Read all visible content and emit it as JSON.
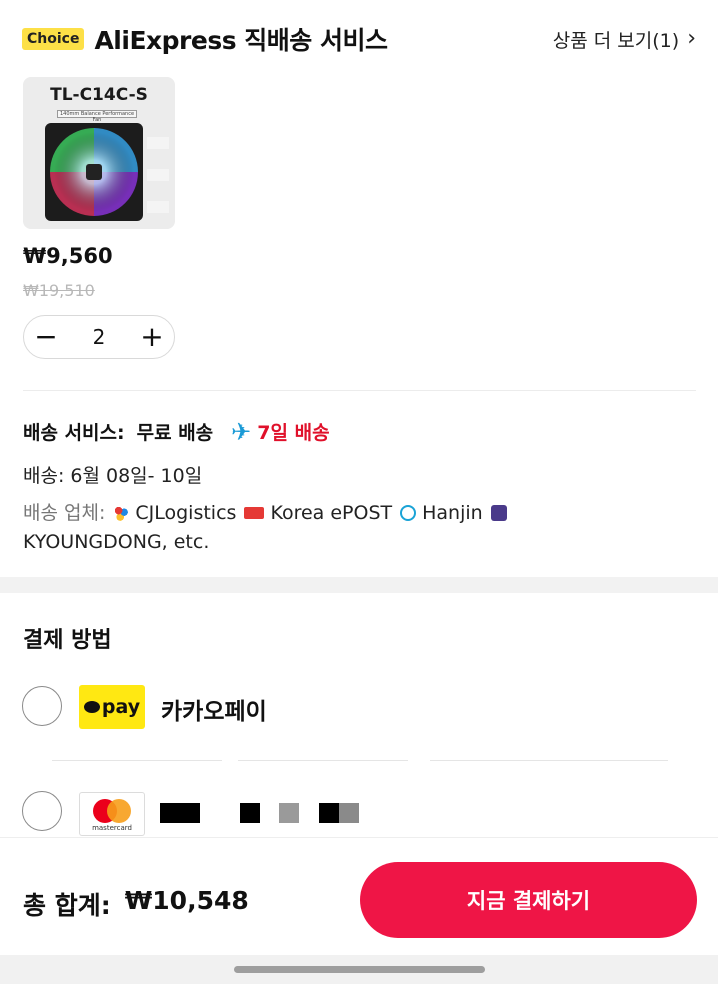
{
  "header": {
    "badge": "Choice",
    "title": "AliExpress 직배송 서비스",
    "more_link": "상품 더 보기(1)",
    "more_chevron": "›"
  },
  "product": {
    "image_model_text": "TL-C14C-S",
    "image_sub_text": "140mm Balance Performance Fan",
    "price": "₩9,560",
    "original_price": "₩19,510",
    "quantity": "2",
    "decrement_symbol": "−",
    "increment_symbol": "+"
  },
  "shipping": {
    "service_label": "배송 서비스:",
    "service_value": "무료 배송",
    "plane_icon": "✈",
    "fast_label": "7일 배송",
    "delivery_date": "배송: 6월 08일- 10일",
    "carriers_label": "배송 업체:",
    "carriers": [
      "CJLogistics",
      "Korea ePOST",
      "Hanjin",
      "KYOUNGDONG, etc."
    ]
  },
  "payment": {
    "title": "결제 방법",
    "kakao_logo_text": "pay",
    "kakao_label": "카카오페이",
    "mastercard_text": "mastercard"
  },
  "footer": {
    "total_label": "총 합계:",
    "total_amount": "₩10,548",
    "pay_button": "지금 결제하기"
  },
  "colors": {
    "accent": "#ef1546",
    "fast_delivery": "#e0102a",
    "choice_badge": "#fde047",
    "kakao_yellow": "#ffe812"
  }
}
